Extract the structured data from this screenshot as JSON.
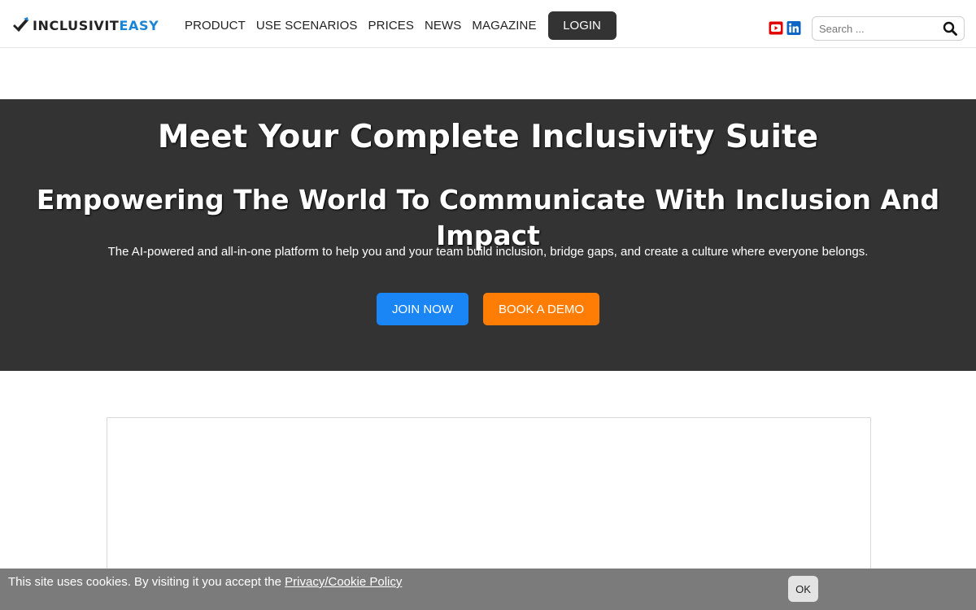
{
  "brand": {
    "name_main": "INCLUSIVIT",
    "name_accent": "EASY",
    "accent_color": "#1a84d6",
    "logo_icon": "checkmark-logo-icon"
  },
  "nav": {
    "items": [
      {
        "label": "PRODUCT"
      },
      {
        "label": "USE SCENARIOS"
      },
      {
        "label": "PRICES"
      },
      {
        "label": "NEWS"
      },
      {
        "label": "MAGAZINE"
      }
    ],
    "login_label": "LOGIN"
  },
  "social": [
    {
      "icon": "youtube-icon",
      "color": "#e00000"
    },
    {
      "icon": "linkedin-icon",
      "color": "#0a66c2"
    }
  ],
  "search": {
    "placeholder": "Search ...",
    "value": ""
  },
  "hero": {
    "title": "Meet Your Complete Inclusivity Suite",
    "subtitle": "Empowering The World To Communicate With Inclusion And Impact",
    "description": "The AI-powered and all-in-one platform to help you and your team build inclusion, bridge gaps, and create a culture where everyone belongs.",
    "background": "#333333",
    "join_label": "JOIN NOW",
    "join_color": "#1a86f5",
    "demo_label": "BOOK A DEMO",
    "demo_color": "#ff7d05"
  },
  "cookie": {
    "text": "This site uses cookies. By visiting it you accept the ",
    "link_label": "Privacy/Cookie Policy",
    "ok_label": "OK"
  }
}
